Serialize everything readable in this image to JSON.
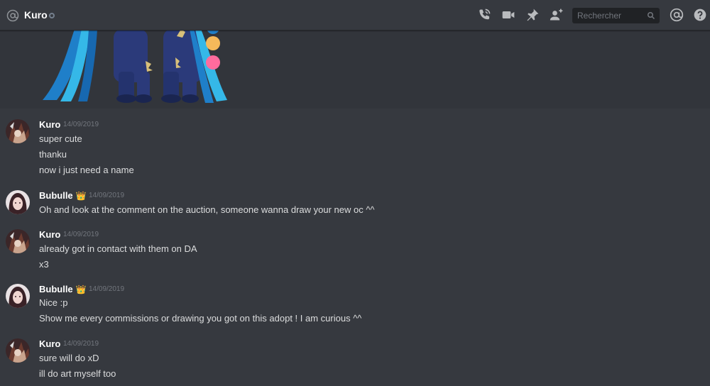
{
  "header": {
    "channel_icon": "at-icon",
    "title": "Kuro",
    "status": "offline",
    "icons": [
      "call-icon",
      "video-icon",
      "pin-icon",
      "add-friend-icon",
      "mention-icon",
      "help-icon"
    ],
    "search_placeholder": "Rechercher"
  },
  "colors": {
    "background": "#36393f",
    "header_text": "#ffffff",
    "message_text": "#dcddde",
    "timestamp": "#72767d",
    "search_bg": "#202225",
    "palette_orange": "#f5b95a",
    "palette_pink": "#ff6b9d"
  },
  "messages": [
    {
      "author": "Kuro",
      "badge": "",
      "timestamp": "14/09/2019",
      "lines": [
        "super cute",
        "thanku",
        "now i just need a name"
      ]
    },
    {
      "author": "Bubulle",
      "badge": "👑",
      "timestamp": "14/09/2019",
      "lines": [
        "Oh and look at the comment on the auction, someone wanna draw your new oc ^^"
      ]
    },
    {
      "author": "Kuro",
      "badge": "",
      "timestamp": "14/09/2019",
      "lines": [
        "already got in contact with them on DA",
        "x3"
      ]
    },
    {
      "author": "Bubulle",
      "badge": "👑",
      "timestamp": "14/09/2019",
      "lines": [
        "Nice :p",
        "Show me every commissions or drawing you got on this adopt ! I am curious ^^"
      ]
    },
    {
      "author": "Kuro",
      "badge": "",
      "timestamp": "14/09/2019",
      "lines": [
        "sure will do xD",
        "ill do art myself too"
      ]
    }
  ]
}
